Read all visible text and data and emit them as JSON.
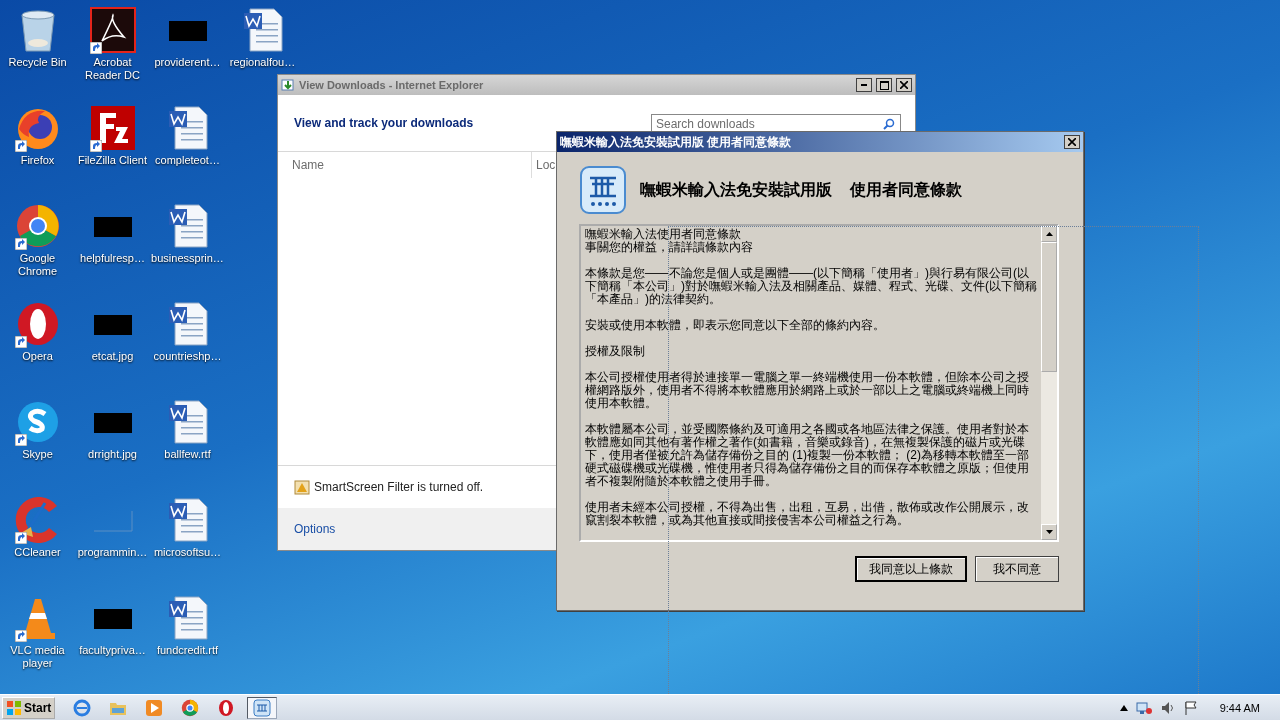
{
  "desktop_icons": [
    {
      "label": "Recycle Bin",
      "kind": "recycle"
    },
    {
      "label": "Firefox",
      "kind": "firefox"
    },
    {
      "label": "Google Chrome",
      "kind": "chrome"
    },
    {
      "label": "Opera",
      "kind": "opera"
    },
    {
      "label": "Skype",
      "kind": "skype"
    },
    {
      "label": "CCleaner",
      "kind": "ccleaner"
    },
    {
      "label": "VLC media player",
      "kind": "vlc"
    },
    {
      "label": "Acrobat Reader DC",
      "kind": "acrobat"
    },
    {
      "label": "FileZilla Client",
      "kind": "filezilla"
    },
    {
      "label": "helpfulresp…",
      "kind": "image"
    },
    {
      "label": "etcat.jpg",
      "kind": "image"
    },
    {
      "label": "drright.jpg",
      "kind": "image"
    },
    {
      "label": "programmin…",
      "kind": "blank"
    },
    {
      "label": "facultypriva…",
      "kind": "image"
    },
    {
      "label": "providerent…",
      "kind": "image"
    },
    {
      "label": "completeot…",
      "kind": "word"
    },
    {
      "label": "businessprin…",
      "kind": "word"
    },
    {
      "label": "countrieshp…",
      "kind": "word"
    },
    {
      "label": "ballfew.rtf",
      "kind": "word"
    },
    {
      "label": "microsoftsu…",
      "kind": "word"
    },
    {
      "label": "fundcredit.rtf",
      "kind": "word"
    },
    {
      "label": "regionalfou…",
      "kind": "word"
    }
  ],
  "downloads_window": {
    "title": "View Downloads - Internet Explorer",
    "heading": "View and track your downloads",
    "search": {
      "placeholder": "Search downloads"
    },
    "columns": [
      "Name",
      "Loc"
    ],
    "smartscreen": "SmartScreen Filter is turned off.",
    "options_link": "Options"
  },
  "dialog": {
    "title": "嘸蝦米輸入法免安裝試用版 使用者同意條款",
    "heading_product": "嘸蝦米輸入法免安裝試用版",
    "heading_terms": "使用者同意條款",
    "paragraphs": [
      [
        "嘸蝦米輸入法使用者同意條款",
        "事關您的權益，請詳讀條款內容"
      ],
      [
        "本條款是您——不論您是個人或是團體——(以下簡稱「使用者」)與行易有限公司(以下簡稱「本公司」)對於嘸蝦米輸入法及相關產品、媒體、程式、光碟、文件(以下簡稱「本產品」)的法律契約。"
      ],
      [
        "安裝或使用本軟體，即表示您同意以下全部的條約內容。"
      ],
      [
        "授權及限制"
      ],
      [
        "本公司授權使用者得於連接單一電腦之單一終端機使用一份本軟體，但除本公司之授權網路版外，使用者不得將本軟體應用於網路上或於一部以上之電腦或終端機上同時使用本軟體。"
      ],
      [
        "本軟體屬本公司，並受國際條約及可適用之各國或各地區法律之保護。使用者對於本軟體應如同其他有著作權之著作(如書籍，音樂或錄音)，在無複製保護的磁片或光碟下，使用者僅被允許為儲存備份之目的 (1)複製一份本軟體； (2)為移轉本軟體至一部硬式磁碟機或光碟機，惟使用者只得為儲存備份之目的而保存本軟體之原版；但使用者不複製附隨於本軟體之使用手冊。"
      ],
      [
        "使用者未經本公司授權，不得為出售，出租，互易，出借，散佈或改作公開展示，改竄割裂本軟體，或為其他直接或間接侵害本公司權益之行為。"
      ]
    ],
    "buttons": [
      {
        "label": "我同意以上條款",
        "selected": true
      },
      {
        "label": "我不同意",
        "selected": false
      }
    ]
  },
  "taskbar": {
    "start": "Start",
    "items": [
      {
        "kind": "ie",
        "selected": false
      },
      {
        "kind": "folder",
        "selected": false
      },
      {
        "kind": "media",
        "selected": false
      },
      {
        "kind": "chrome",
        "selected": false
      },
      {
        "kind": "opera",
        "selected": false
      },
      {
        "kind": "app",
        "selected": true
      }
    ],
    "clock": "9:44 AM"
  }
}
